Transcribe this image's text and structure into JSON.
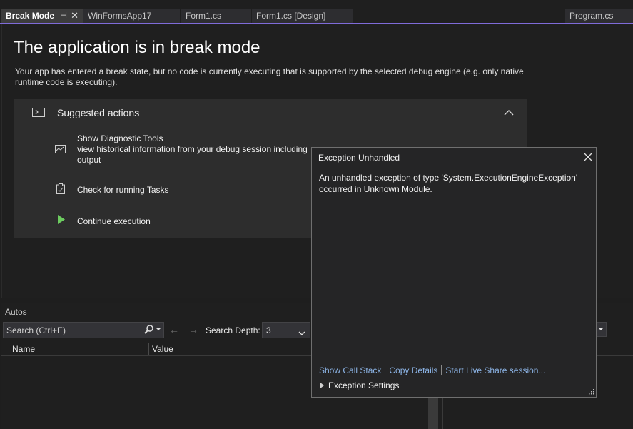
{
  "tabs": [
    {
      "label": "Break Mode",
      "active": true
    },
    {
      "label": "WinFormsApp17",
      "active": false
    },
    {
      "label": "Form1.cs",
      "active": false
    },
    {
      "label": "Form1.cs [Design]",
      "active": false
    },
    {
      "label": "Program.cs",
      "active": false
    }
  ],
  "break_mode": {
    "title": "The application is in break mode",
    "description": "Your app has entered a break state, but no code is currently executing that is supported by the selected debug engine (e.g. only native runtime code is executing).",
    "suggested": {
      "label": "Suggested actions",
      "items": [
        {
          "title": "Show Diagnostic Tools",
          "detail": "view historical information from your debug session including",
          "detail2": "output",
          "icon": "diagnostic-chart-icon"
        },
        {
          "title": "Check for running Tasks",
          "icon": "clipboard-check-icon"
        },
        {
          "title": "Continue execution",
          "icon": "play-icon"
        }
      ]
    }
  },
  "autos": {
    "title": "Autos",
    "search_placeholder": "Search (Ctrl+E)",
    "search_depth_label": "Search Depth:",
    "search_depth_value": "3",
    "columns": [
      "Name",
      "Value"
    ]
  },
  "exception": {
    "title": "Exception Unhandled",
    "message": "An unhandled exception of type 'System.ExecutionEngineException' occurred in Unknown Module.",
    "links": [
      "Show Call Stack",
      "Copy Details",
      "Start Live Share session..."
    ],
    "settings_label": "Exception Settings"
  },
  "colors": {
    "accent": "#7f6bd9",
    "link": "#8cb4e6",
    "play": "#6ccb5f"
  }
}
